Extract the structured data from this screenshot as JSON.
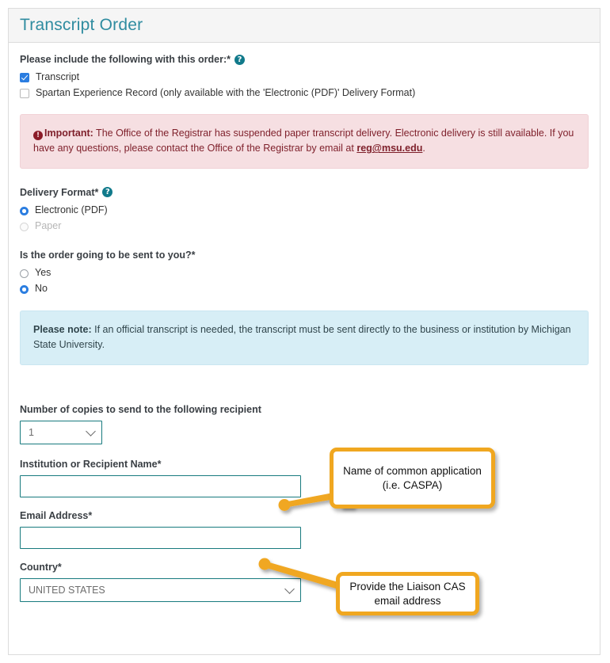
{
  "panel": {
    "title": "Transcript Order"
  },
  "include_section": {
    "label": "Please include the following with this order:*",
    "help_icon": "help-circle-icon",
    "options": [
      {
        "label": "Transcript",
        "checked": true
      },
      {
        "label": "Spartan Experience Record (only available with the 'Electronic (PDF)' Delivery Format)",
        "checked": false
      }
    ]
  },
  "alert_important": {
    "icon": "exclamation-circle-icon",
    "strong": "Important:",
    "text_before": " The Office of the Registrar has suspended paper transcript delivery. Electronic delivery is still available. If you have any questions, please contact the Office of the Registrar by email at ",
    "link": "reg@msu.edu",
    "text_after": "."
  },
  "delivery_format": {
    "label": "Delivery Format*",
    "help_icon": "help-circle-icon",
    "options": [
      {
        "label": "Electronic (PDF)",
        "selected": true,
        "disabled": false
      },
      {
        "label": "Paper",
        "selected": false,
        "disabled": true
      }
    ]
  },
  "sent_to_you": {
    "label": "Is the order going to be sent to you?*",
    "options": [
      {
        "label": "Yes",
        "selected": false
      },
      {
        "label": "No",
        "selected": true
      }
    ]
  },
  "alert_note": {
    "strong": "Please note:",
    "text": " If an official transcript is needed, the transcript must be sent directly to the business or institution by Michigan State University."
  },
  "recipient": {
    "copies_label": "Number of copies to send to the following recipient",
    "copies_value": "1",
    "institution_label": "Institution or Recipient Name*",
    "institution_value": "",
    "email_label": "Email Address*",
    "email_value": "",
    "country_label": "Country*",
    "country_value": "UNITED STATES"
  },
  "callouts": [
    {
      "text": "Name of common application (i.e. CASPA)"
    },
    {
      "text": "Provide the Liaison CAS email address"
    }
  ],
  "colors": {
    "header_text": "#2f8ca0",
    "header_bg": "#f5f5f5",
    "input_border": "#177a7e",
    "radio_selected": "#2b7de0",
    "alert_danger_bg": "#f6dfe2",
    "alert_danger_text": "#7e1f2a",
    "alert_info_bg": "#d7eef6",
    "callout_border": "#f0a720"
  }
}
